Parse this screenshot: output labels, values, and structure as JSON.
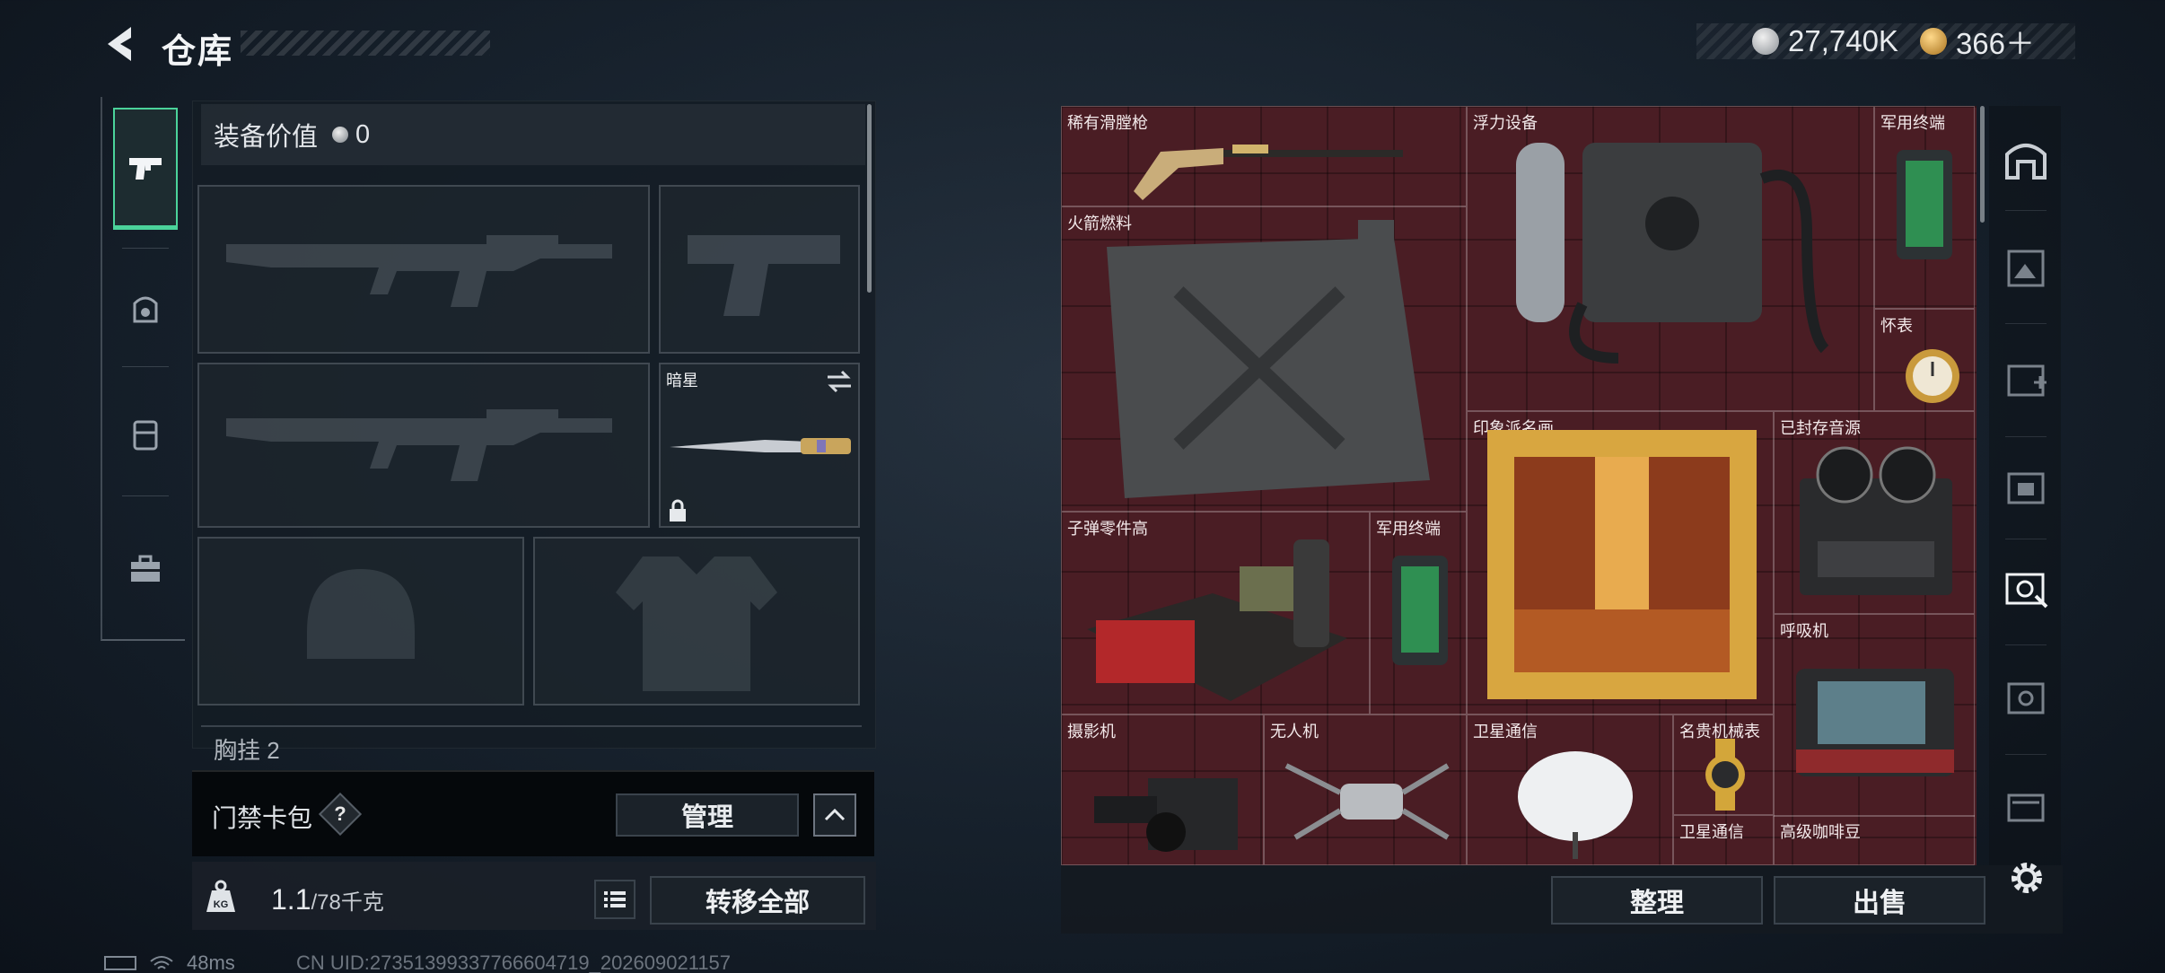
{
  "header": {
    "title": "仓库",
    "silver_amount": "27,740K",
    "gold_amount": "366＋"
  },
  "left_nav": {
    "items": [
      {
        "name": "weapons",
        "icon": "pistol-icon",
        "active": true
      },
      {
        "name": "armor",
        "icon": "helmet-icon",
        "active": false
      },
      {
        "name": "backpack",
        "icon": "backpack-icon",
        "active": false
      },
      {
        "name": "toolbox",
        "icon": "toolbox-icon",
        "active": false
      }
    ]
  },
  "equipment": {
    "value_label": "装备价值",
    "value_amount": "0",
    "melee_name": "暗星",
    "chest_label": "胸挂  2"
  },
  "access_card": {
    "label": "门禁卡包",
    "help": "?",
    "manage": "管理"
  },
  "weight": {
    "current": "1.1",
    "capacity": "/78千克",
    "transfer_all": "转移全部"
  },
  "status": {
    "ping": "48ms",
    "uid": "CN UID:27351399337766604719_202609021157"
  },
  "storage": {
    "items": [
      {
        "label": "稀有滑膛枪"
      },
      {
        "label": "浮力设备"
      },
      {
        "label": "军用终端"
      },
      {
        "label": "火箭燃料"
      },
      {
        "label": "怀表"
      },
      {
        "label": "印象派名画"
      },
      {
        "label": "已封存音源"
      },
      {
        "label": "子弹零件高"
      },
      {
        "label": "军用终端"
      },
      {
        "label": "呼吸机"
      },
      {
        "label": "摄影机"
      },
      {
        "label": "无人机"
      },
      {
        "label": "卫星通信"
      },
      {
        "label": "名贵机械表"
      },
      {
        "label": "卫星通信"
      },
      {
        "label": "高级咖啡豆"
      }
    ],
    "sort_button": "整理",
    "sell_button": "出售"
  },
  "right_nav": {
    "tabs": [
      "storage-home-icon",
      "storage-tab-1-icon",
      "storage-tab-4a-icon",
      "storage-tab-4b-icon",
      "storage-tab-active-icon",
      "storage-tab-4c-icon",
      "storage-tab-3-icon"
    ],
    "settings_icon": "gear-icon"
  },
  "colors": {
    "accent_green": "#4bd39a",
    "storage_bg": "#4a1d24",
    "gold": "#d8a640"
  }
}
